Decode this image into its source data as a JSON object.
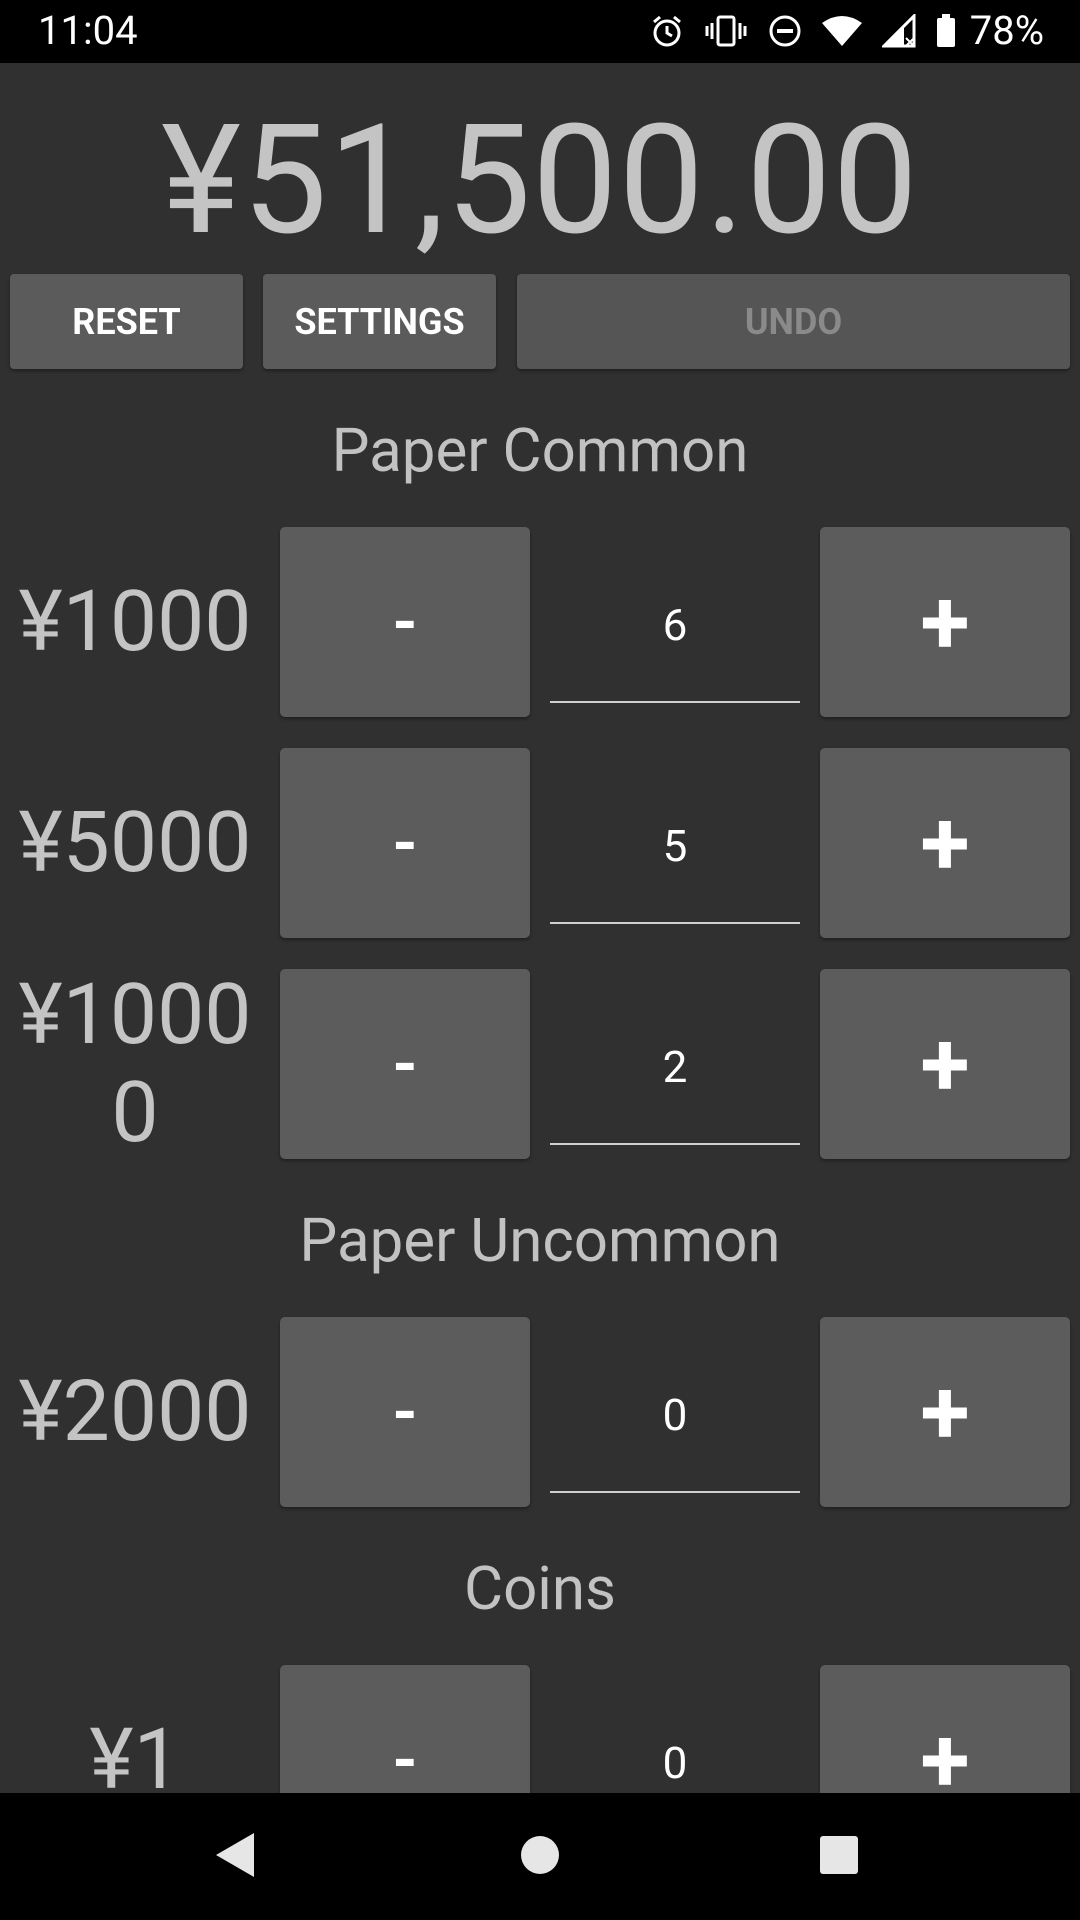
{
  "status": {
    "time": "11:04",
    "battery": "78%",
    "icons": [
      "alarm-icon",
      "vibrate-icon",
      "do-not-disturb-icon",
      "wifi-icon",
      "cell-signal-icon",
      "battery-icon"
    ]
  },
  "total": "¥51,500.00",
  "actions": {
    "reset": "RESET",
    "settings": "SETTINGS",
    "undo": "UNDO"
  },
  "sections": [
    {
      "title": "Paper Common",
      "rows": [
        {
          "label": "¥1000",
          "minus": "-",
          "count": "6",
          "plus": "+"
        },
        {
          "label": "¥5000",
          "minus": "-",
          "count": "5",
          "plus": "+"
        },
        {
          "label": "¥10000",
          "minus": "-",
          "count": "2",
          "plus": "+"
        }
      ]
    },
    {
      "title": "Paper Uncommon",
      "rows": [
        {
          "label": "¥2000",
          "minus": "-",
          "count": "0",
          "plus": "+"
        }
      ]
    },
    {
      "title": "Coins",
      "rows": [
        {
          "label": "¥1",
          "minus": "-",
          "count": "0",
          "plus": "+"
        }
      ]
    }
  ],
  "nav": [
    "back-icon",
    "home-icon",
    "recents-icon"
  ],
  "colors": {
    "background": "#303030",
    "button": "#5c5c5d",
    "text_light": "#c4c4c4",
    "disabled_text": "#8a8a8a"
  }
}
